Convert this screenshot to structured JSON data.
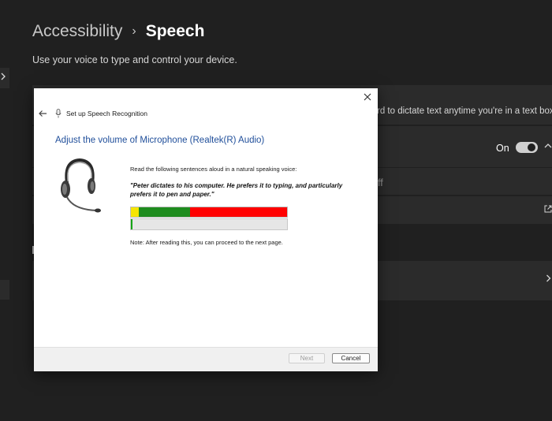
{
  "page": {
    "breadcrumb_parent": "Accessibility",
    "breadcrumb_separator": "›",
    "breadcrumb_current": "Speech",
    "subtitle": "Use your voice to type and control your device.",
    "voice_typing_desc": "rd to dictate text anytime you're in a text box",
    "toggle_label": "On",
    "toggle_state": "on",
    "off_fragment": "ff"
  },
  "dialog": {
    "title": "Set up Speech Recognition",
    "heading": "Adjust the volume of Microphone (Realtek(R) Audio)",
    "instruction": "Read the following sentences aloud in a natural speaking voice:",
    "quote_line1": "\"Peter dictates to his computer. He prefers it to typing, and particularly",
    "quote_line2": "prefers it to pen and paper.\"",
    "note": "Note: After reading this, you can proceed to the next page.",
    "next_label": "Next",
    "cancel_label": "Cancel",
    "next_enabled": false,
    "level_fraction": 0.01,
    "meter_zones": [
      {
        "color": "#f5e500",
        "fraction": 0.05
      },
      {
        "color": "#1e8c1e",
        "fraction": 0.33
      },
      {
        "color": "#ff0000",
        "fraction": 0.62
      }
    ]
  },
  "colors": {
    "background": "#202020",
    "card": "#2b2b2b",
    "heading_blue": "#1f4e9a"
  },
  "icons": {
    "close": "close-icon",
    "back": "back-arrow-icon",
    "mic": "microphone-icon",
    "headset": "headset-icon",
    "external": "external-link-icon",
    "chevron": "chevron-right-icon"
  }
}
